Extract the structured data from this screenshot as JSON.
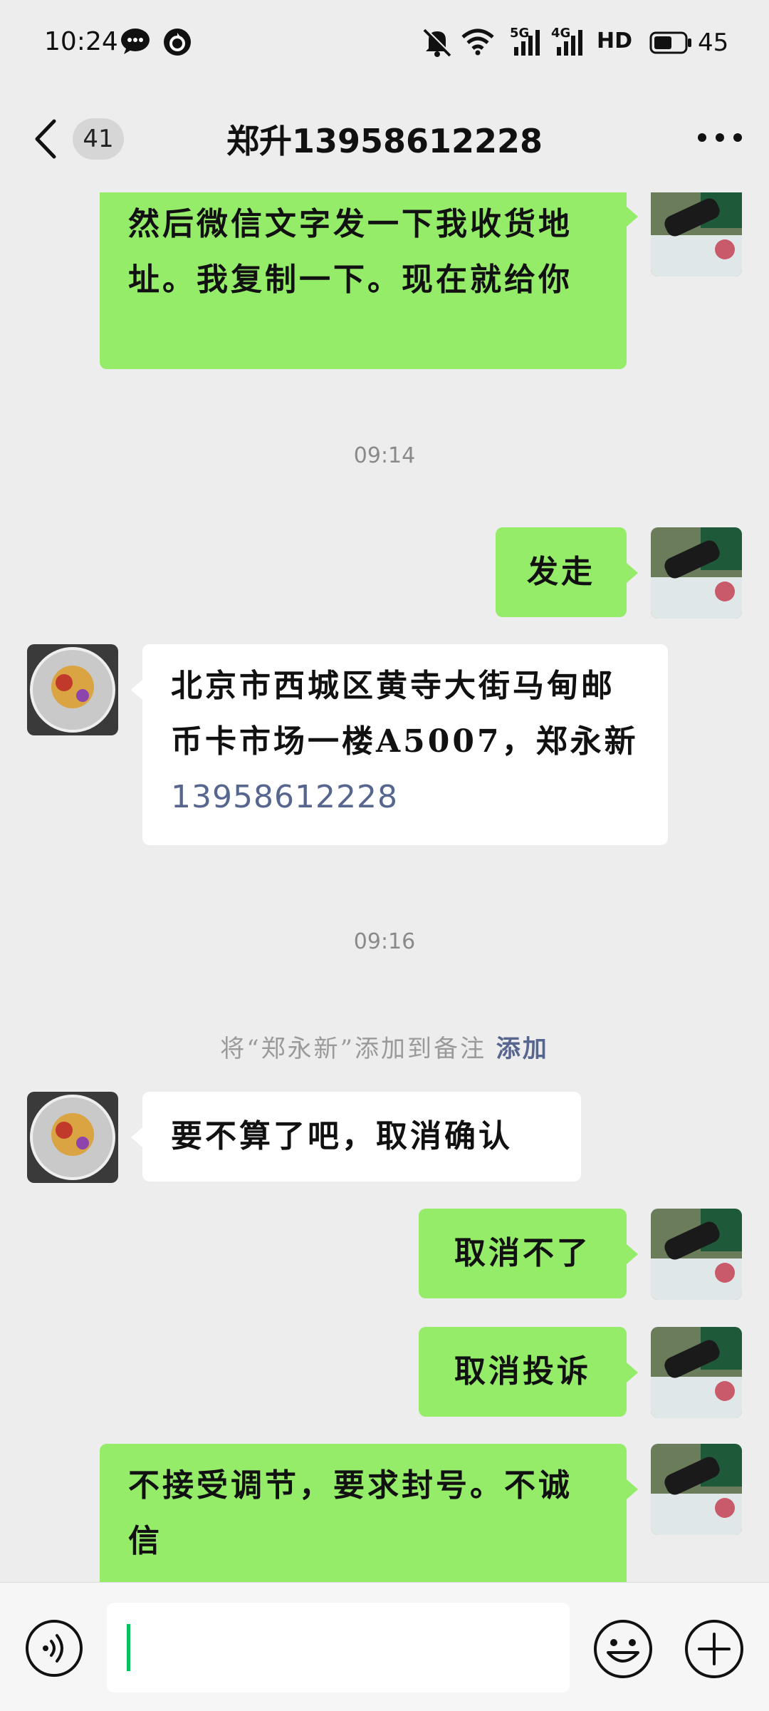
{
  "status_bar": {
    "time": "10:24",
    "network_1": "5G",
    "network_2": "4G",
    "hd_label": "HD",
    "battery": "45"
  },
  "header": {
    "unread_count": "41",
    "title": "郑升13958612228"
  },
  "messages": [
    {
      "side": "out",
      "text": "然后微信文字发一下我收货地址。我复制一下。现在就给你"
    },
    {
      "side": "time",
      "text": "09:14"
    },
    {
      "side": "out",
      "text": "发走"
    },
    {
      "side": "in",
      "text": "北京市西城区黄寺大街马甸邮币卡市场一楼A5007，郑永新",
      "phone": "13958612228"
    },
    {
      "side": "time",
      "text": "09:16"
    },
    {
      "side": "system",
      "text": "将“郑永新”添加到备注",
      "link": "添加"
    },
    {
      "side": "in",
      "text": "要不算了吧，取消确认"
    },
    {
      "side": "out",
      "text": "取消不了"
    },
    {
      "side": "out",
      "text": "取消投诉"
    },
    {
      "side": "out",
      "text": "不接受调节，要求封号。不诚信"
    }
  ],
  "input": {
    "value": ""
  },
  "colors": {
    "bubble_out": "#95ec69",
    "bubble_in": "#ffffff",
    "link": "#56668f",
    "background": "#ededed",
    "caret": "#07c160"
  },
  "icons": {
    "back": "chevron-left-icon",
    "more": "more-dots-icon",
    "voice": "voice-icon",
    "emoji": "emoji-icon",
    "plus": "plus-circle-icon"
  }
}
